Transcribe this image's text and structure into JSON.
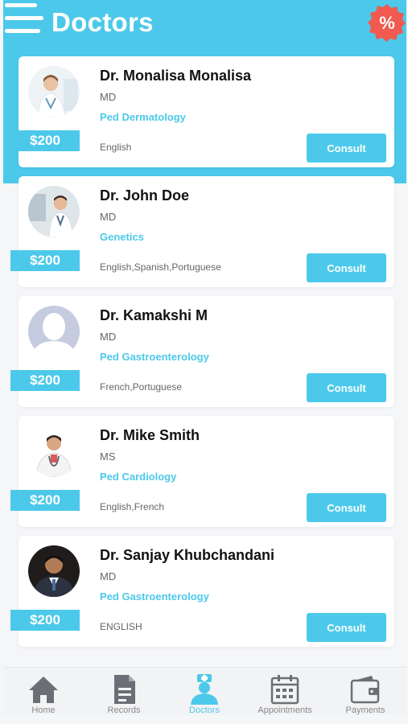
{
  "header": {
    "title": "Doctors",
    "discount_symbol": "%"
  },
  "doctors": [
    {
      "name": "Dr.  Monalisa Monalisa",
      "degree": "MD",
      "specialty": "Ped Dermatology",
      "languages": "English",
      "price": "$200",
      "consult_label": "Consult",
      "avatar": "doctor-photo"
    },
    {
      "name": "Dr. John Doe",
      "degree": "MD",
      "specialty": "Genetics",
      "languages": "English,Spanish,Portuguese",
      "price": "$200",
      "consult_label": "Consult",
      "avatar": "doctor-photo"
    },
    {
      "name": "Dr. Kamakshi M",
      "degree": "MD",
      "specialty": "Ped Gastroenterology",
      "languages": "French,Portuguese",
      "price": "$200",
      "consult_label": "Consult",
      "avatar": "placeholder"
    },
    {
      "name": "Dr. Mike Smith",
      "degree": "MS",
      "specialty": "Ped Cardiology",
      "languages": "English,French",
      "price": "$200",
      "consult_label": "Consult",
      "avatar": "doctor-photo"
    },
    {
      "name": "Dr. Sanjay Khubchandani",
      "degree": "MD",
      "specialty": "Ped Gastroenterology",
      "languages": "ENGLISH",
      "price": "$200",
      "consult_label": "Consult",
      "avatar": "doctor-photo"
    }
  ],
  "bottom_nav": [
    {
      "label": "Home",
      "icon": "home-icon",
      "active": false
    },
    {
      "label": "Records",
      "icon": "records-icon",
      "active": false
    },
    {
      "label": "Doctors",
      "icon": "doctor-icon",
      "active": true
    },
    {
      "label": "Appointments",
      "icon": "calendar-icon",
      "active": false
    },
    {
      "label": "Payments",
      "icon": "wallet-icon",
      "active": false
    }
  ],
  "colors": {
    "accent": "#4cc9ea",
    "discount_badge": "#f05a4f",
    "nav_inactive": "#888888"
  }
}
